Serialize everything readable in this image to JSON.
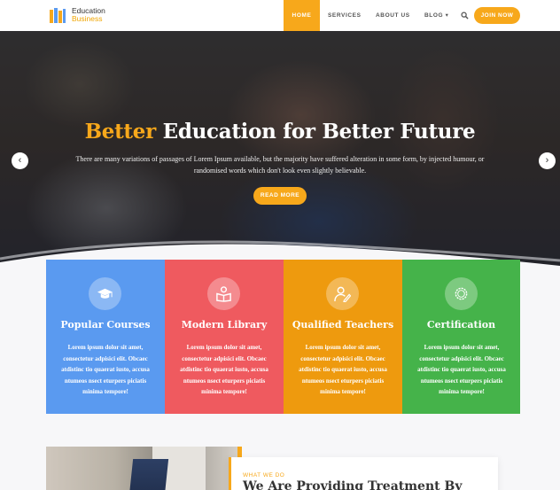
{
  "brand": {
    "line1": "Education",
    "line2": "Business"
  },
  "nav": {
    "items": [
      "HOME",
      "SERVICES",
      "ABOUT US",
      "BLOG"
    ],
    "blog_caret": "▾",
    "join_label": "JOIN NOW"
  },
  "hero": {
    "title_highlight": "Better",
    "title_rest": "Education for Better Future",
    "subtitle": "There are many variations of passages of Lorem Ipsum available, but the majority have suffered alteration in some form, by injected humour, or randomised words which don't look even slightly believable.",
    "button_label": "READ MORE",
    "prev": "‹",
    "next": "›"
  },
  "features": [
    {
      "title": "Popular Courses",
      "text": "Lorem ipsum dolor sit amet, consectetur adpisici elit. Obcaec atdistinc tio quaerat iusto, accusa ntumeos nsect eturpers piciatis minima tempore!",
      "icon": "graduation-cap-icon",
      "color": "#5a9af0"
    },
    {
      "title": "Modern Library",
      "text": "Lorem ipsum dolor sit amet, consectetur adpisici elit. Obcaec atdistinc tio quaerat iusto, accusa ntumeos nsect eturpers piciatis minima tempore!",
      "icon": "reader-book-icon",
      "color": "#ef5a5f"
    },
    {
      "title": "Qualified Teachers",
      "text": "Lorem ipsum dolor sit amet, consectetur adpisici elit. Obcaec atdistinc tio quaerat iusto, accusa ntumeos nsect eturpers piciatis minima tempore!",
      "icon": "teacher-icon",
      "color": "#ee9a0e"
    },
    {
      "title": "Certification",
      "text": "Lorem ipsum dolor sit amet, consectetur adpisici elit. Obcaec atdistinc tio quaerat iusto, accusa ntumeos nsect eturpers piciatis minima tempore!",
      "icon": "certificate-seal-icon",
      "color": "#45b34a"
    }
  ],
  "about": {
    "label": "WHAT WE DO",
    "title": "We Are Providing Treatment By"
  },
  "colors": {
    "accent": "#f7a81b",
    "text": "#333333"
  }
}
